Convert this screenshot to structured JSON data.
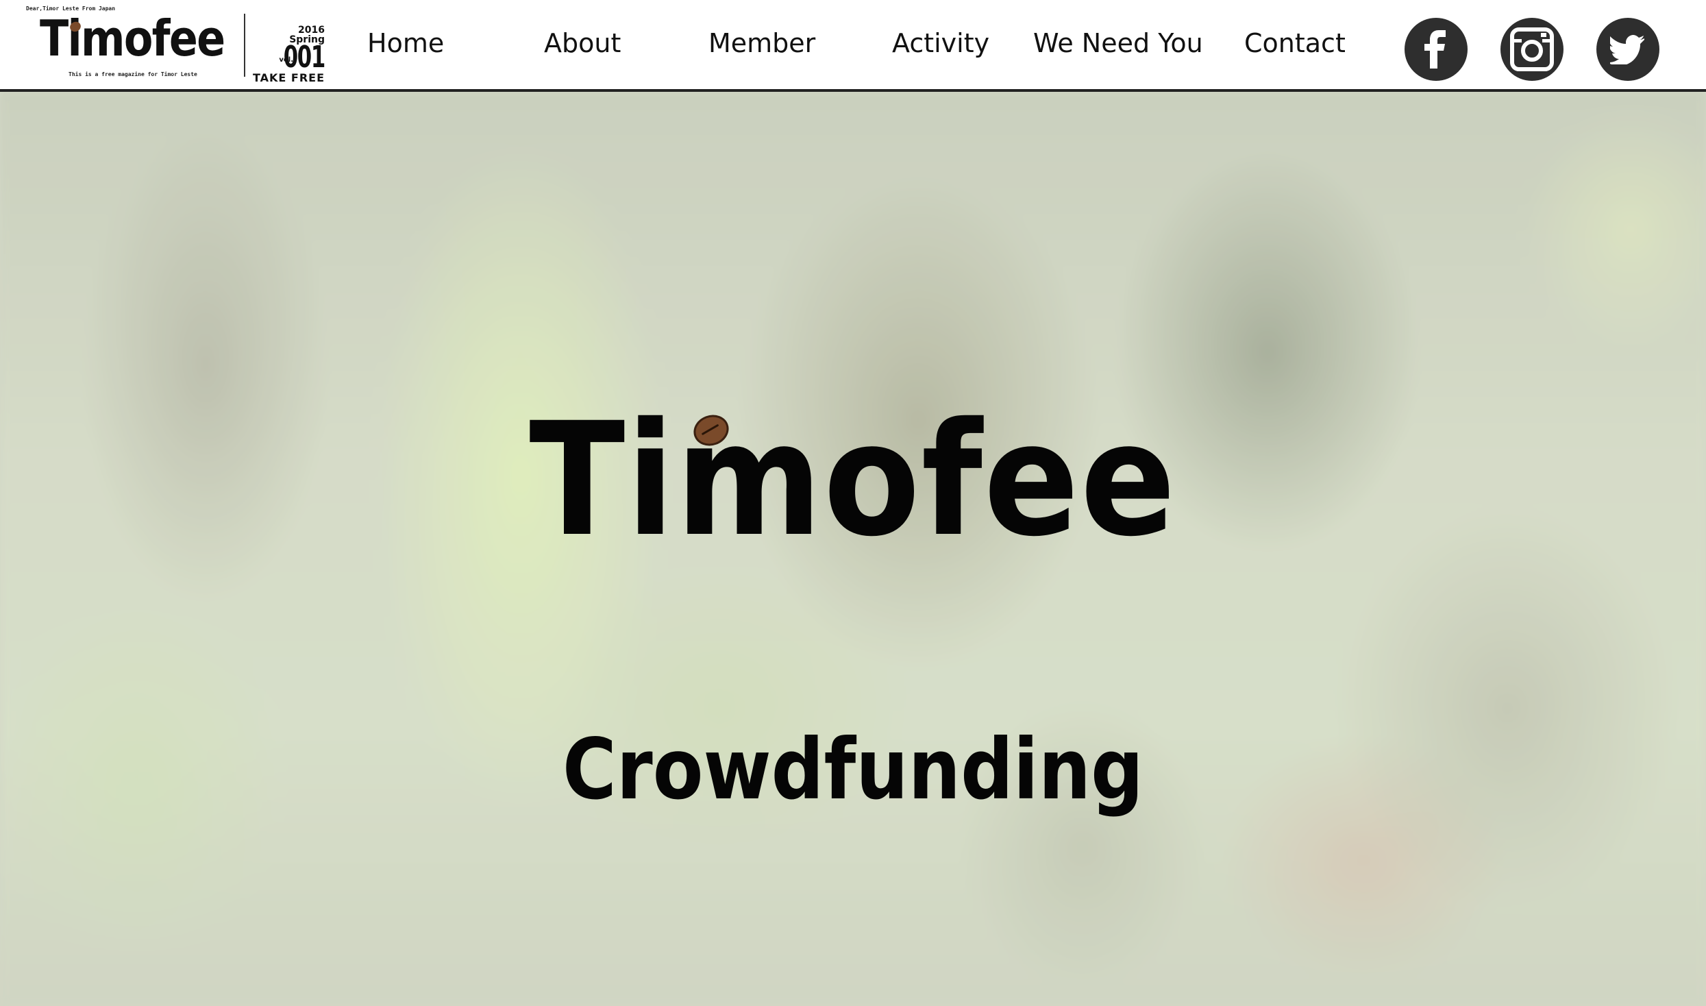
{
  "logo": {
    "tagline_top": "Dear,Timor Leste From Japan",
    "wordmark": "Timofee",
    "tagline_bottom": "This is a free magazine for Timor Leste",
    "issue_year": "2016",
    "issue_season": "Spring",
    "issue_vol": "vol.",
    "issue_number": "001",
    "issue_free": "TAKE FREE"
  },
  "nav": {
    "items": [
      {
        "label": "Home"
      },
      {
        "label": "About"
      },
      {
        "label": "Member"
      },
      {
        "label": "Activity"
      },
      {
        "label": "We Need You"
      },
      {
        "label": "Contact"
      }
    ]
  },
  "social": [
    {
      "icon": "facebook-icon"
    },
    {
      "icon": "instagram-icon"
    },
    {
      "icon": "twitter-icon"
    }
  ],
  "hero": {
    "title": "Timofee",
    "subtitle": "Crowdfunding"
  },
  "colors": {
    "header_bg": "#ffffff",
    "header_border": "#222222",
    "social_bg": "#2e2e2e",
    "coffee_bean": "#7a4a2a",
    "text": "#050505"
  }
}
